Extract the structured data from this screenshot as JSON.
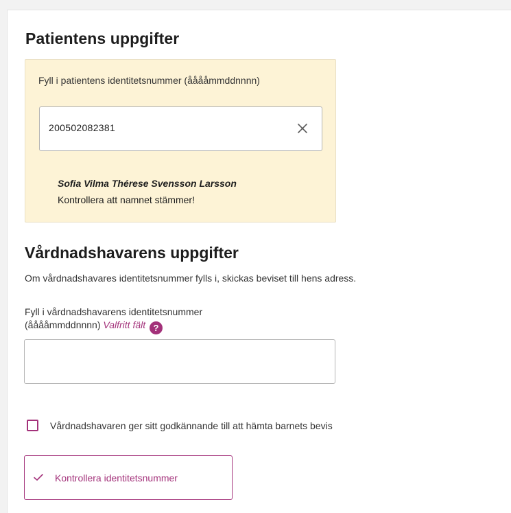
{
  "patient": {
    "heading": "Patientens uppgifter",
    "id_label": "Fyll i patientens identitetsnummer (ååååmmddnnnn)",
    "id_value": "200502082381",
    "name": "Sofia Vilma Thérese Svensson Larsson",
    "name_check": "Kontrollera att namnet stämmer!"
  },
  "guardian": {
    "heading": "Vårdnadshavarens uppgifter",
    "description": "Om vårdnadshavares identitetsnummer fylls i, skickas beviset till hens adress.",
    "id_label_line1": "Fyll i vårdnadshavarens identitetsnummer",
    "id_label_line2": "(ååååmmddnnnn)",
    "optional_label": "Valfritt fält",
    "help_glyph": "?",
    "id_value": "",
    "consent_label": "Vårdnadshavaren ger sitt godkännande till att hämta barnets bevis",
    "consent_checked": false
  },
  "actions": {
    "verify_label": "Kontrollera identitetsnummer"
  },
  "colors": {
    "accent": "#a3317a",
    "patient_box_bg": "#fdf3d6"
  },
  "icons": {
    "clear": "close-icon",
    "help": "question-mark-icon",
    "verify": "checkmark-icon"
  }
}
